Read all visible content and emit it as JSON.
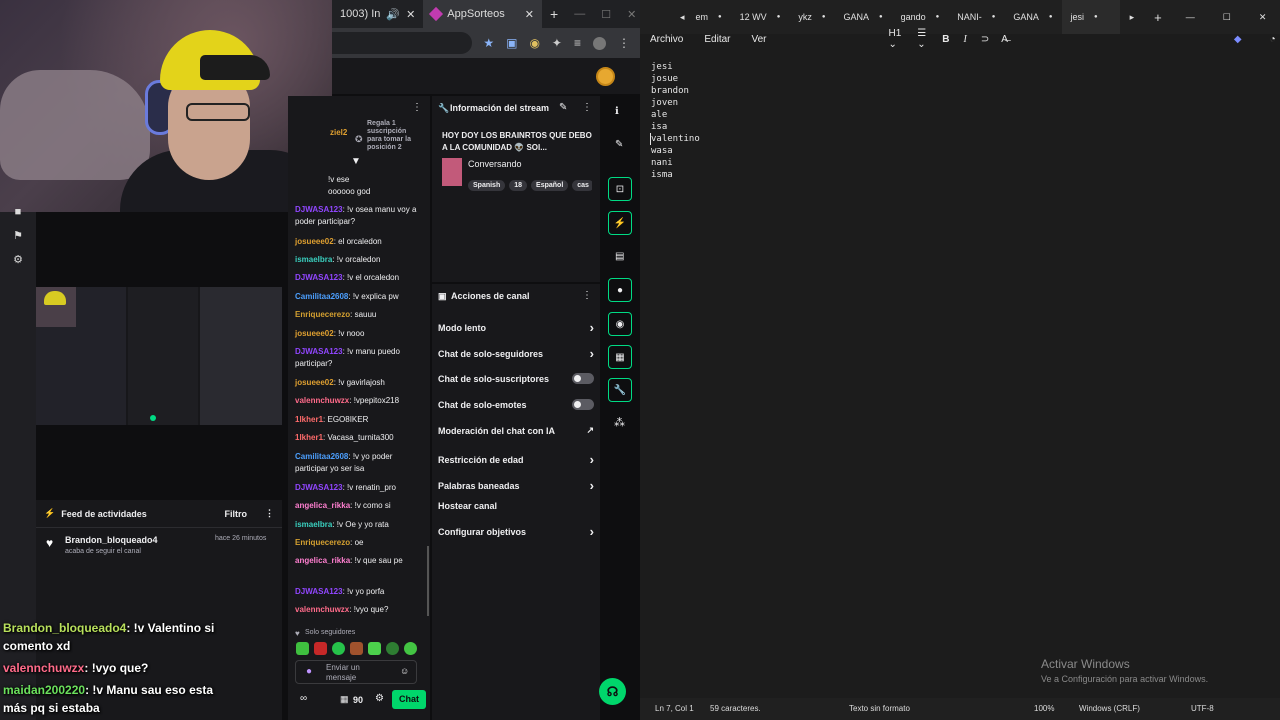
{
  "browser": {
    "tab_partial": "1003) In",
    "tab_active": "AppSorteos",
    "new_tab": "+",
    "win_min": "—",
    "win_max": "☐",
    "win_close": "✕"
  },
  "activity_feed": {
    "title": "Feed de actividades",
    "filter": "Filtro",
    "event_user": "Brandon_bloqueado4",
    "event_time": "hace 26 minutos",
    "event_desc": "acaba de seguir el canal"
  },
  "overlay_chat": [
    {
      "user": "Brandon_bloqueado4",
      "text": ": !v Valentino si",
      "color": "#b8e05c"
    },
    {
      "user": "",
      "text": "comento xd",
      "color": "#ffffff"
    },
    {
      "user": "valennchuwzx",
      "text": ": !vyo que?",
      "color": "#ff6b8a"
    },
    {
      "user": "maidan200220",
      "text": ": !v Manu sau eso esta",
      "color": "#6be05c"
    },
    {
      "user": "",
      "text": "más pq si estaba",
      "color": "#ffffff"
    }
  ],
  "chat": {
    "top_user_partial": "ziel2",
    "gift_text": "Regala 1 suscripción para tomar la posición 2",
    "messages": [
      {
        "user": "",
        "text": "!v ese",
        "color": "#efeff1"
      },
      {
        "user": "",
        "text": "oooooo god",
        "color": "#efeff1"
      },
      {
        "user": "DJWASA123",
        "text": ": !v osea manu voy a poder participar?",
        "color": "#9146ff"
      },
      {
        "user": "josueee02",
        "text": ": el orcaledon",
        "color": "#e0a030"
      },
      {
        "user": "ismaelbra",
        "text": ": !v orcaledon",
        "color": "#3ad1c0"
      },
      {
        "user": "DJWASA123",
        "text": ": !v el orcaledon",
        "color": "#9146ff"
      },
      {
        "user": "Camilitaa2608",
        "text": ": !v explica pw",
        "color": "#4c9ffe"
      },
      {
        "user": "Enriquecerezo",
        "text": ": sauuu",
        "color": "#d4a030"
      },
      {
        "user": "josueee02",
        "text": ": !v nooo",
        "color": "#e0a030"
      },
      {
        "user": "DJWASA123",
        "text": ": !v manu puedo participar?",
        "color": "#9146ff"
      },
      {
        "user": "josueee02",
        "text": ": !v gavirlajosh",
        "color": "#e0a030"
      },
      {
        "user": "valennchuwzx",
        "text": ": !vpepitox218",
        "color": "#ff6b8a"
      },
      {
        "user": "1lkher1",
        "text": ": EGO8IKER",
        "color": "#ff6b6b"
      },
      {
        "user": "1lkher1",
        "text": ": Vacasa_turnita300",
        "color": "#ff6b6b"
      },
      {
        "user": "Camilitaa2608",
        "text": ": !v yo poder participar yo ser isa",
        "color": "#4c9ffe"
      },
      {
        "user": "DJWASA123",
        "text": ": !v renatin_pro",
        "color": "#9146ff"
      },
      {
        "user": "angelica_rikka",
        "text": ": !v como si",
        "color": "#ff7fd0"
      },
      {
        "user": "ismaelbra",
        "text": ": !v Oe y yo rata",
        "color": "#3ad1c0"
      },
      {
        "user": "Enriquecerezo",
        "text": ": oe",
        "color": "#d4a030"
      },
      {
        "user": "angelica_rikka",
        "text": ": !v que sau pe",
        "color": "#ff7fd0"
      },
      {
        "user": "DJWASA123",
        "text": ": !v yo porfa",
        "color": "#9146ff"
      },
      {
        "user": "valennchuwzx",
        "text": ": !vyo que?",
        "color": "#ff6b8a"
      }
    ],
    "followers_only": "Solo seguidores",
    "input_placeholder": "Enviar un mensaje",
    "points": "90",
    "chat_button": "Chat"
  },
  "stream_info": {
    "title": "Información del stream",
    "stream_title": "HOY DOY LOS BRAINRTOS QUE DEBO A LA COMUNIDAD 👽 SOI...",
    "category": "Conversando",
    "tags": [
      "Spanish",
      "18",
      "Español",
      "cas"
    ]
  },
  "channel_actions": {
    "title": "Acciones de canal",
    "items": [
      {
        "label": "Modo lento",
        "kind": "chevron"
      },
      {
        "label": "Chat de solo-seguidores",
        "kind": "chevron"
      },
      {
        "label": "Chat de solo-suscriptores",
        "kind": "toggle"
      },
      {
        "label": "Chat de solo-emotes",
        "kind": "toggle"
      },
      {
        "label": "Moderación del chat con IA",
        "kind": "external"
      },
      {
        "label": "Restricción de edad",
        "kind": "chevron"
      },
      {
        "label": "Palabras baneadas",
        "kind": "chevron"
      },
      {
        "label": "Hostear canal",
        "kind": "none"
      },
      {
        "label": "Configurar objetivos",
        "kind": "chevron"
      }
    ]
  },
  "notepad": {
    "tabs": [
      "em",
      "12 WV",
      "ykz",
      "GANA",
      "gando",
      "NANI-",
      "GANA",
      "jesi"
    ],
    "active_tab": "jesi",
    "menu": [
      "Archivo",
      "Editar",
      "Ver"
    ],
    "heading_select": "H1",
    "lines": [
      "jesi",
      "josue",
      "brandon",
      "joven",
      "ale",
      "isa",
      "valentino",
      "wasa",
      "nani",
      "isma"
    ],
    "status": {
      "position": "Ln 7, Col 1",
      "chars": "59 caracteres.",
      "format": "Texto sin formato",
      "zoom": "100%",
      "eol": "Windows (CRLF)",
      "encoding": "UTF-8"
    },
    "watermark_title": "Activar Windows",
    "watermark_sub": "Ve a Configuración para activar Windows."
  },
  "colors": {
    "twitch_green": "#00db84",
    "chat_button": "#00d66b"
  }
}
